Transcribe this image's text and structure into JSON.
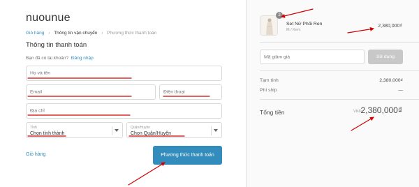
{
  "shop": {
    "name": "nuounue"
  },
  "breadcrumb": {
    "cart": "Giỏ hàng",
    "shipping_info": "Thông tin vận chuyển",
    "payment_method": "Phương thức thanh toán"
  },
  "section_title": "Thông tin thanh toán",
  "login": {
    "prompt": "Bạn đã có tài khoản?",
    "link": "Đăng nhập"
  },
  "form": {
    "name_placeholder": "Họ và tên",
    "email_placeholder": "Email",
    "phone_placeholder": "Điện thoại",
    "address_placeholder": "Địa chỉ",
    "city_label": "Tỉnh",
    "city_value": "Chọn tỉnh thành",
    "district_label": "Quận/Huyện",
    "district_value": "Chọn Quận/Huyện"
  },
  "footer": {
    "cart_link": "Giỏ hàng",
    "continue_button": "Phương thức thanh toán"
  },
  "order": {
    "product": {
      "name": "Set Nữ Phối Ren",
      "variant": "M / Kem",
      "price": "2,380,000₫",
      "quantity": "2"
    },
    "discount": {
      "placeholder": "Mã giảm giá",
      "apply": "Sử dụng"
    },
    "subtotal_label": "Tạm tính",
    "subtotal_value": "2,380,000₫",
    "shipping_label": "Phí ship",
    "shipping_value": "—",
    "total_label": "Tổng tiền",
    "total_currency": "VND",
    "total_value": "2,380,000₫"
  },
  "colors": {
    "link": "#338dbc",
    "button": "#338dbc",
    "apply_disabled": "#c8c8c8",
    "annotation": "#d10000"
  },
  "icons": {
    "breadcrumb_separator": "chevron-right-icon",
    "select_arrow": "chevron-down-icon",
    "annotation_arrow": "red-arrow-icon"
  }
}
